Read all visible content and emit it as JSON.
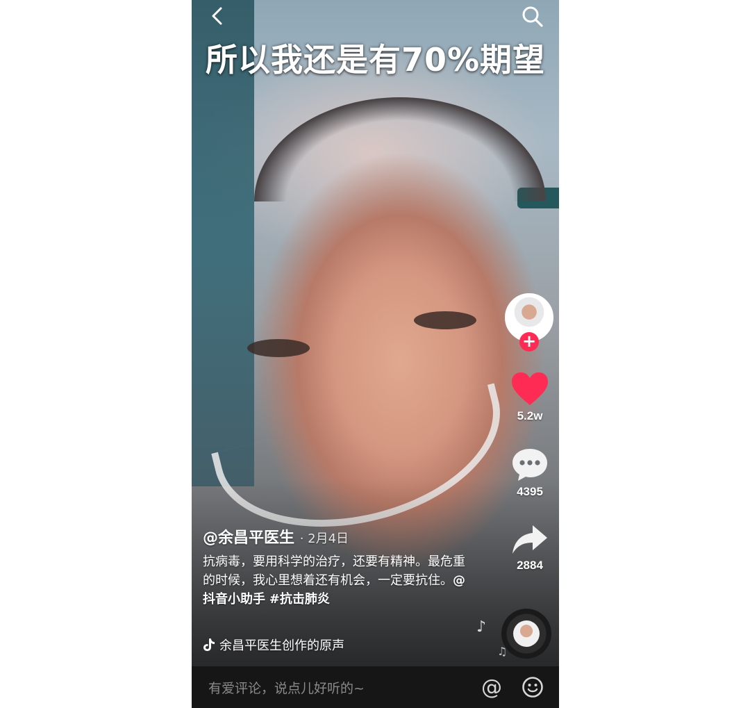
{
  "video": {
    "caption": "所以我还是有70%期望"
  },
  "topbar": {
    "back_icon": "chevron-left-icon",
    "search_icon": "search-icon"
  },
  "rail": {
    "follow_symbol": "+",
    "likes": "5.2w",
    "comments": "4395",
    "shares": "2884",
    "like_color": "#fe2c55",
    "follow_color": "#fe2c55"
  },
  "post": {
    "author": "@余昌平医生",
    "date": "· 2月4日",
    "description_text": "抗病毒，要用科学的治疗，还要有精神。最危重的时候，我心里想着还有机会，一定要抗住。",
    "mention": "@抖音小助手",
    "hashtag": "#抗击肺炎",
    "music": "余昌平医生创作的原声"
  },
  "comment_bar": {
    "placeholder": "有爱评论，说点儿好听的~",
    "at_symbol": "@"
  }
}
